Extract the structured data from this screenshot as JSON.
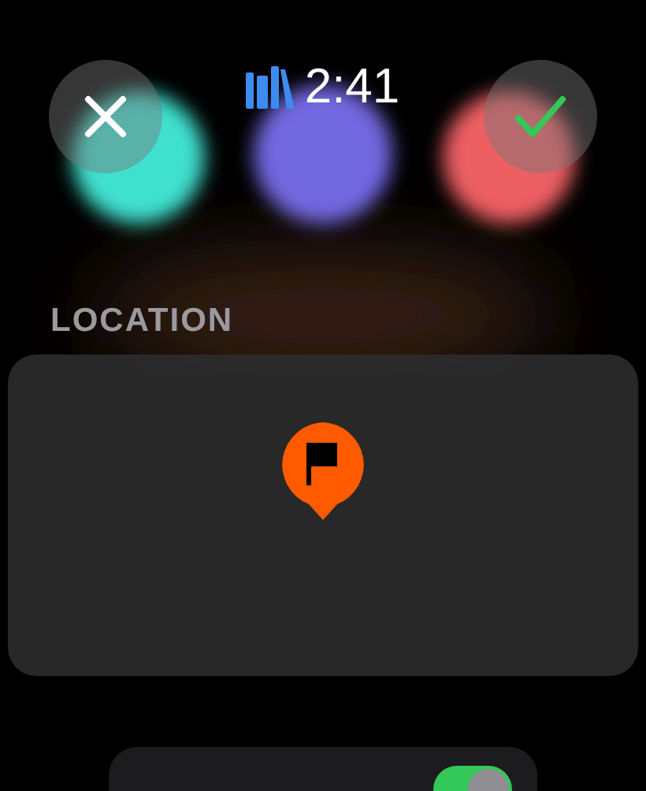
{
  "status_bar": {
    "time": "2:41"
  },
  "header": {
    "buttons": [
      {
        "kind": "cancel"
      },
      {
        "kind": "confirm"
      }
    ]
  },
  "location": {
    "label": "LOCATION",
    "pin": {
      "color": "#ff5a00"
    }
  },
  "bottom_card": {
    "toggle": {
      "on": true
    }
  }
}
